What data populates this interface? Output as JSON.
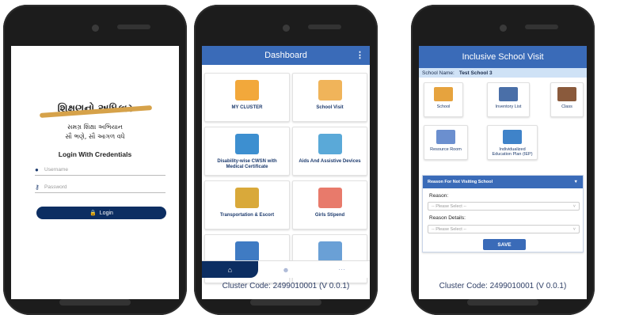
{
  "phone1": {
    "logo_title": "શિક્ષણનો અધિકાર",
    "logo_line1": "સમગ્ર શિક્ષા અભિયાન",
    "logo_line2": "સૌ ભણે, સૌ આગળ વધે",
    "heading": "Login With Credentials",
    "username_placeholder": "Username",
    "password_placeholder": "Password",
    "login_label": "Login"
  },
  "phone2": {
    "title": "Dashboard",
    "tiles": [
      {
        "label": "MY CLUSTER",
        "color": "#f2a83b"
      },
      {
        "label": "School Visit",
        "color": "#f0b45a"
      },
      {
        "label": "Disability-wise CWSN with Medical Certificate",
        "color": "#3d8fd0"
      },
      {
        "label": "Aids And Assistive Devices",
        "color": "#5aa9d8"
      },
      {
        "label": "Transportation & Escort",
        "color": "#d9a93a"
      },
      {
        "label": "Girls Stipend",
        "color": "#e87a6b"
      },
      {
        "label": "",
        "color": "#3f7bc3"
      },
      {
        "label": "",
        "color": "#6aa0d6"
      }
    ],
    "cluster_code": "Cluster Code: 2499010001 (V 0.0.1)"
  },
  "phone3": {
    "title": "Inclusive School Visit",
    "school_label": "School Name:",
    "school_value": "Test School 3",
    "tiles": [
      {
        "label": "School",
        "color": "#e6a33e"
      },
      {
        "label": "Inventory List",
        "color": "#4a6fa8"
      },
      {
        "label": "Class",
        "color": "#8a5a3c"
      },
      {
        "label": "Resource Room",
        "color": "#6b8fcf"
      },
      {
        "label": "Individualized Education Plan (IEP)",
        "color": "#3f83c9"
      }
    ],
    "reason_header": "Reason For Not Visiting School",
    "reason_label": "Reason:",
    "reason_select": "-- Please Select --",
    "details_label": "Reason Details:",
    "details_select": "-- Please Select --",
    "save_label": "SAVE",
    "cluster_code": "Cluster Code: 2499010001 (V 0.0.1)"
  }
}
